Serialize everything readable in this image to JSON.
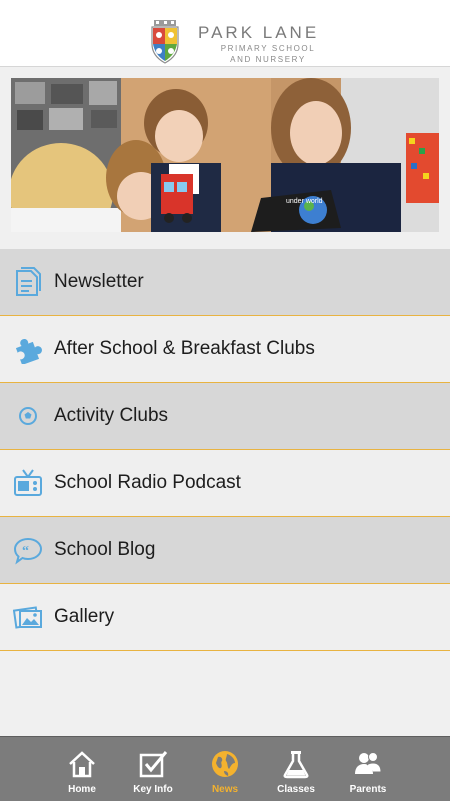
{
  "header": {
    "brand_title": "PARK LANE",
    "brand_sub_line1": "PRIMARY SCHOOL",
    "brand_sub_line2": "AND NURSERY"
  },
  "hero": {
    "book_text": "under world"
  },
  "menu": {
    "items": [
      {
        "label": "Newsletter",
        "icon": "document-icon"
      },
      {
        "label": "After School & Breakfast Clubs",
        "icon": "puzzle-icon"
      },
      {
        "label": "Activity Clubs",
        "icon": "football-icon"
      },
      {
        "label": "School Radio Podcast",
        "icon": "radio-icon"
      },
      {
        "label": "School Blog",
        "icon": "speech-bubble-icon"
      },
      {
        "label": "Gallery",
        "icon": "pictures-icon"
      }
    ]
  },
  "tabbar": {
    "tabs": [
      {
        "label": "Home",
        "icon": "house-icon"
      },
      {
        "label": "Key Info",
        "icon": "checkbox-icon"
      },
      {
        "label": "News",
        "icon": "globe-icon",
        "active": true
      },
      {
        "label": "Classes",
        "icon": "flask-icon"
      },
      {
        "label": "Parents",
        "icon": "people-icon"
      }
    ]
  },
  "colors": {
    "accent": "#f4b22e",
    "divider": "#e8b341",
    "icon_blue": "#5aa9dd",
    "tabbar_bg": "#7c7c7c",
    "row_dark": "#d7d7d7",
    "row_light": "#efefef"
  }
}
